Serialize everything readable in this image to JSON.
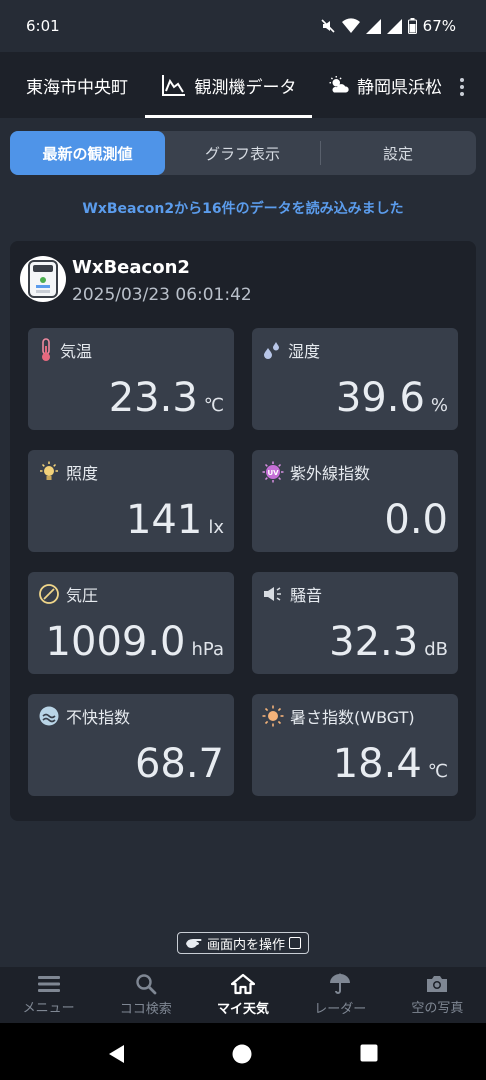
{
  "status_bar": {
    "time": "6:01",
    "battery": "67%"
  },
  "top_tabs": [
    {
      "label": "東海市中央町"
    },
    {
      "label": "観測機データ",
      "icon": "chart-line-icon"
    },
    {
      "label": "静岡県浜松",
      "icon": "sun-cloud-icon"
    }
  ],
  "segments": [
    {
      "label": "最新の観測値",
      "active": true
    },
    {
      "label": "グラフ表示"
    },
    {
      "label": "設定"
    }
  ],
  "notice": "WxBeacon2から16件のデータを読み込みました",
  "device": {
    "name": "WxBeacon2",
    "timestamp": "2025/03/23 06:01:42"
  },
  "tiles": [
    {
      "label": "気温",
      "value": "23.3",
      "unit": "℃",
      "icon": "thermometer-icon"
    },
    {
      "label": "湿度",
      "value": "39.6",
      "unit": "%",
      "icon": "droplets-icon"
    },
    {
      "label": "照度",
      "value": "141",
      "unit": "lx",
      "icon": "light-bulb-icon"
    },
    {
      "label": "紫外線指数",
      "value": "0.0",
      "unit": "",
      "icon": "uv-icon"
    },
    {
      "label": "気圧",
      "value": "1009.0",
      "unit": "hPa",
      "icon": "gauge-icon"
    },
    {
      "label": "騒音",
      "value": "32.3",
      "unit": "dB",
      "icon": "speaker-icon"
    },
    {
      "label": "不快指数",
      "value": "68.7",
      "unit": "",
      "icon": "discomfort-face-icon"
    },
    {
      "label": "暑さ指数(WBGT)",
      "value": "18.4",
      "unit": "℃",
      "icon": "sun-icon"
    }
  ],
  "operate_button": "画面内を操作",
  "bottom_nav": [
    {
      "label": "メニュー",
      "icon": "menu-icon"
    },
    {
      "label": "ココ検索",
      "icon": "search-icon"
    },
    {
      "label": "マイ天気",
      "icon": "home-icon",
      "active": true
    },
    {
      "label": "レーダー",
      "icon": "umbrella-icon"
    },
    {
      "label": "空の写真",
      "icon": "camera-icon"
    }
  ],
  "colors": {
    "accent": "#4f94e8",
    "notice": "#5b9cec",
    "tile_bg": "#373e4a",
    "card_bg": "#1d2129"
  }
}
